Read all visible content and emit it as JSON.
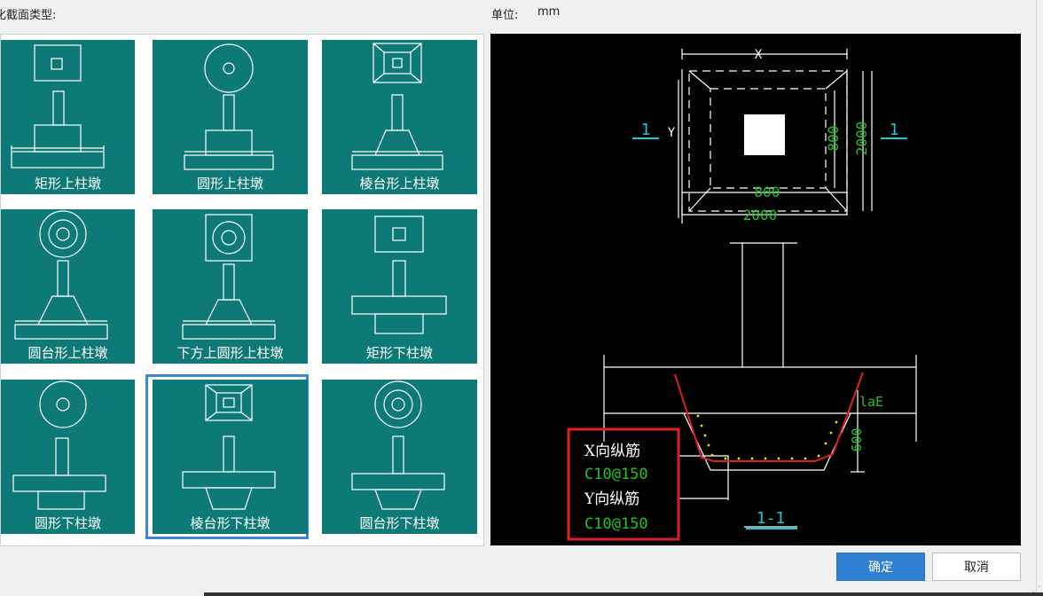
{
  "section_title": "化截面类型:",
  "unit": {
    "label": "单位:",
    "value": "mm"
  },
  "tiles": [
    {
      "label": "矩形上柱墩",
      "icon": "rect-upper-pier-icon",
      "selected": false
    },
    {
      "label": "圆形上柱墩",
      "icon": "circle-upper-pier-icon",
      "selected": false
    },
    {
      "label": "棱台形上柱墩",
      "icon": "frustum-upper-pier-icon",
      "selected": false
    },
    {
      "label": "圆台形上柱墩",
      "icon": "cone-frustum-upper-pier-icon",
      "selected": false
    },
    {
      "label": "下方上圆形上柱墩",
      "icon": "square-bottom-round-top-upper-pier-icon",
      "selected": false
    },
    {
      "label": "矩形下柱墩",
      "icon": "rect-lower-pier-icon",
      "selected": false
    },
    {
      "label": "圆形下柱墩",
      "icon": "circle-lower-pier-icon",
      "selected": false
    },
    {
      "label": "棱台形下柱墩",
      "icon": "frustum-lower-pier-icon",
      "selected": true
    },
    {
      "label": "圆台形下柱墩",
      "icon": "cone-frustum-lower-pier-icon",
      "selected": false
    }
  ],
  "preview": {
    "dim_x": "X",
    "dim_y": "Y",
    "dim_outer_width": "2000",
    "dim_inner_width": "800",
    "dim_inner_height": "800",
    "dim_outer_height": "2000",
    "section_mark_left": "1",
    "section_mark_right": "1",
    "anchorage_label": "laE",
    "depth_label": "600",
    "x_rebar_label": "X向纵筋",
    "x_rebar_value": "C10@150",
    "y_rebar_label": "Y向纵筋",
    "y_rebar_value": "C10@150",
    "section_name": "1-1"
  },
  "buttons": {
    "ok": "确定",
    "cancel": "取消"
  },
  "colors": {
    "tile_bg": "#0e7a78",
    "selected_border": "#3d86d8",
    "ok_bg": "#2f7fd2",
    "cad_green": "#22c22a",
    "cad_cyan": "#18c8d8",
    "cad_red": "#e02020",
    "cad_yellow": "#e8e800"
  }
}
